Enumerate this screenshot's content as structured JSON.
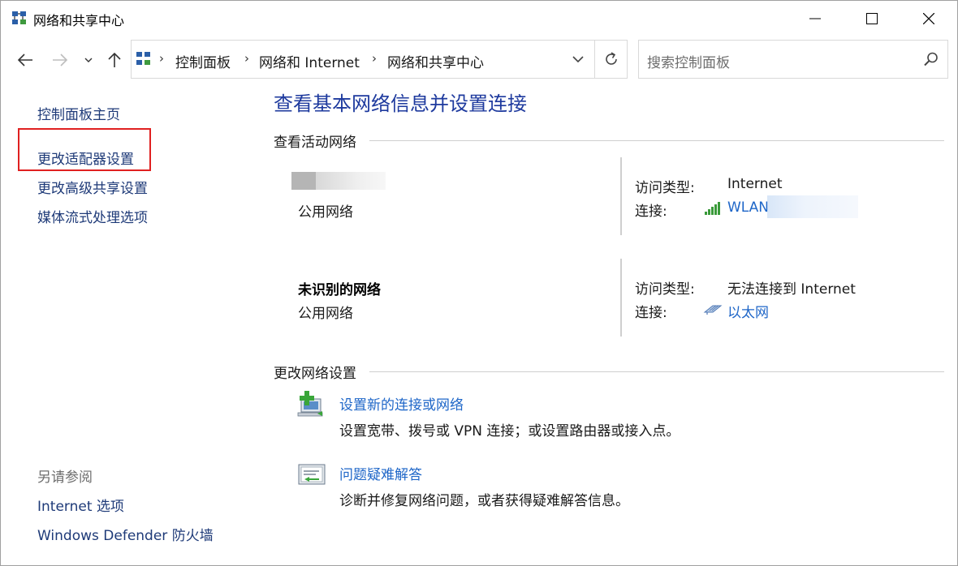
{
  "window": {
    "title": "网络和共享中心",
    "icon": "network-center-icon"
  },
  "address_bar": {
    "crumbs": [
      "控制面板",
      "网络和 Internet",
      "网络和共享中心"
    ]
  },
  "search": {
    "placeholder": "搜索控制面板"
  },
  "sidebar": {
    "home": "控制面板主页",
    "links": [
      "更改适配器设置",
      "更改高级共享设置",
      "媒体流式处理选项"
    ],
    "see_also_title": "另请参阅",
    "see_also": [
      "Internet 选项",
      "Windows Defender 防火墙"
    ]
  },
  "main": {
    "title": "查看基本网络信息并设置连接",
    "active_networks_heading": "查看活动网络",
    "networks": [
      {
        "name": "",
        "category": "公用网络",
        "access_label": "访问类型:",
        "access_value": "Internet",
        "connection_label": "连接:",
        "connection_value": "WLAN",
        "connection_icon": "wifi-signal-icon"
      },
      {
        "name": "未识别的网络",
        "category": "公用网络",
        "access_label": "访问类型:",
        "access_value": "无法连接到 Internet",
        "connection_label": "连接:",
        "connection_value": "以太网",
        "connection_icon": "ethernet-icon"
      }
    ],
    "change_settings_heading": "更改网络设置",
    "tasks": [
      {
        "link": "设置新的连接或网络",
        "desc": "设置宽带、拨号或 VPN 连接；或设置路由器或接入点。",
        "icon": "new-connection-icon"
      },
      {
        "link": "问题疑难解答",
        "desc": "诊断并修复网络问题，或者获得疑难解答信息。",
        "icon": "troubleshoot-icon"
      }
    ]
  },
  "colors": {
    "link": "#1e66c8",
    "nav_link": "#1e3a78",
    "title": "#1e3a9e",
    "highlight": "#e02020"
  }
}
